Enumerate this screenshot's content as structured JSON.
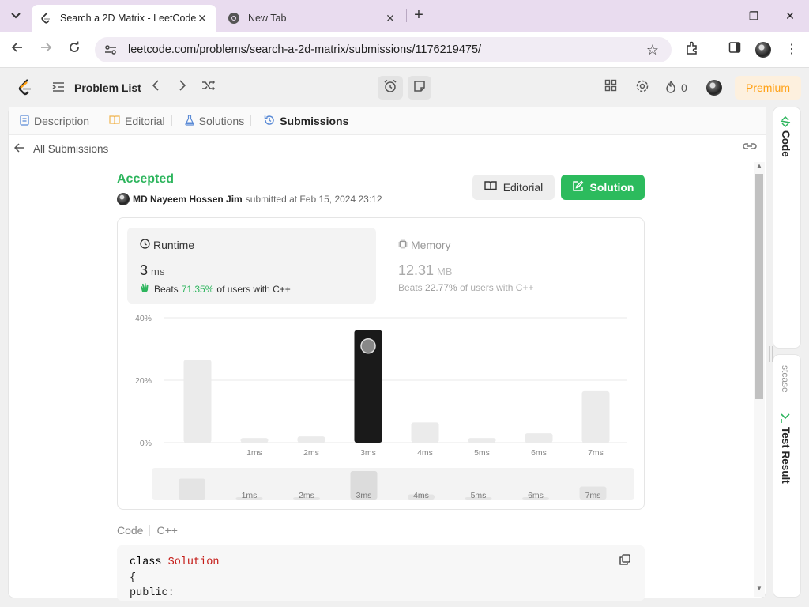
{
  "browser": {
    "tabs": [
      {
        "title": "Search a 2D Matrix - LeetCode",
        "active": true
      },
      {
        "title": "New Tab",
        "active": false
      }
    ],
    "url": "leetcode.com/problems/search-a-2d-matrix/submissions/1176219475/"
  },
  "header": {
    "problem_list": "Problem List",
    "streak_count": "0",
    "premium": "Premium"
  },
  "panel_tabs": [
    {
      "label": "Description",
      "icon": "description-icon"
    },
    {
      "label": "Editorial",
      "icon": "book-icon"
    },
    {
      "label": "Solutions",
      "icon": "flask-icon"
    },
    {
      "label": "Submissions",
      "icon": "history-icon"
    }
  ],
  "nav": {
    "all_submissions": "All Submissions"
  },
  "submission": {
    "status": "Accepted",
    "author": "MD Nayeem Hossen Jim",
    "submitted_text": "submitted at Feb 15, 2024 23:12",
    "editorial_btn": "Editorial",
    "solution_btn": "Solution"
  },
  "runtime": {
    "label": "Runtime",
    "value": "3",
    "unit": "ms",
    "beats_prefix": "Beats",
    "beats_pct": "71.35%",
    "beats_suffix": "of users with C++"
  },
  "memory": {
    "label": "Memory",
    "value": "12.31",
    "unit": "MB",
    "beats_prefix": "Beats",
    "beats_pct": "22.77%",
    "beats_suffix": "of users with C++"
  },
  "chart_data": {
    "type": "bar",
    "categories": [
      "",
      "1ms",
      "2ms",
      "3ms",
      "4ms",
      "5ms",
      "6ms",
      "7ms"
    ],
    "values": [
      26.5,
      1.5,
      2,
      36,
      6.5,
      1.5,
      3,
      16.5
    ],
    "highlight_index": 3,
    "yticks": [
      "0%",
      "20%",
      "40%"
    ],
    "ylim": [
      0,
      40
    ],
    "grid": true,
    "colors": {
      "bar": "#ebebeb",
      "highlight": "#1a1a1a"
    }
  },
  "minimap": {
    "labels": [
      "",
      "1ms",
      "2ms",
      "3ms",
      "4ms",
      "5ms",
      "6ms",
      "7ms"
    ]
  },
  "code": {
    "label": "Code",
    "language": "C++",
    "lines": [
      "class Solution",
      "{",
      "public:"
    ]
  },
  "side_panel": {
    "code_tab": "Code",
    "testcase_tab": "stcase",
    "result_tab": "Test Result"
  },
  "colors": {
    "accent_green": "#2db55d",
    "premium_orange": "#ffa116"
  }
}
